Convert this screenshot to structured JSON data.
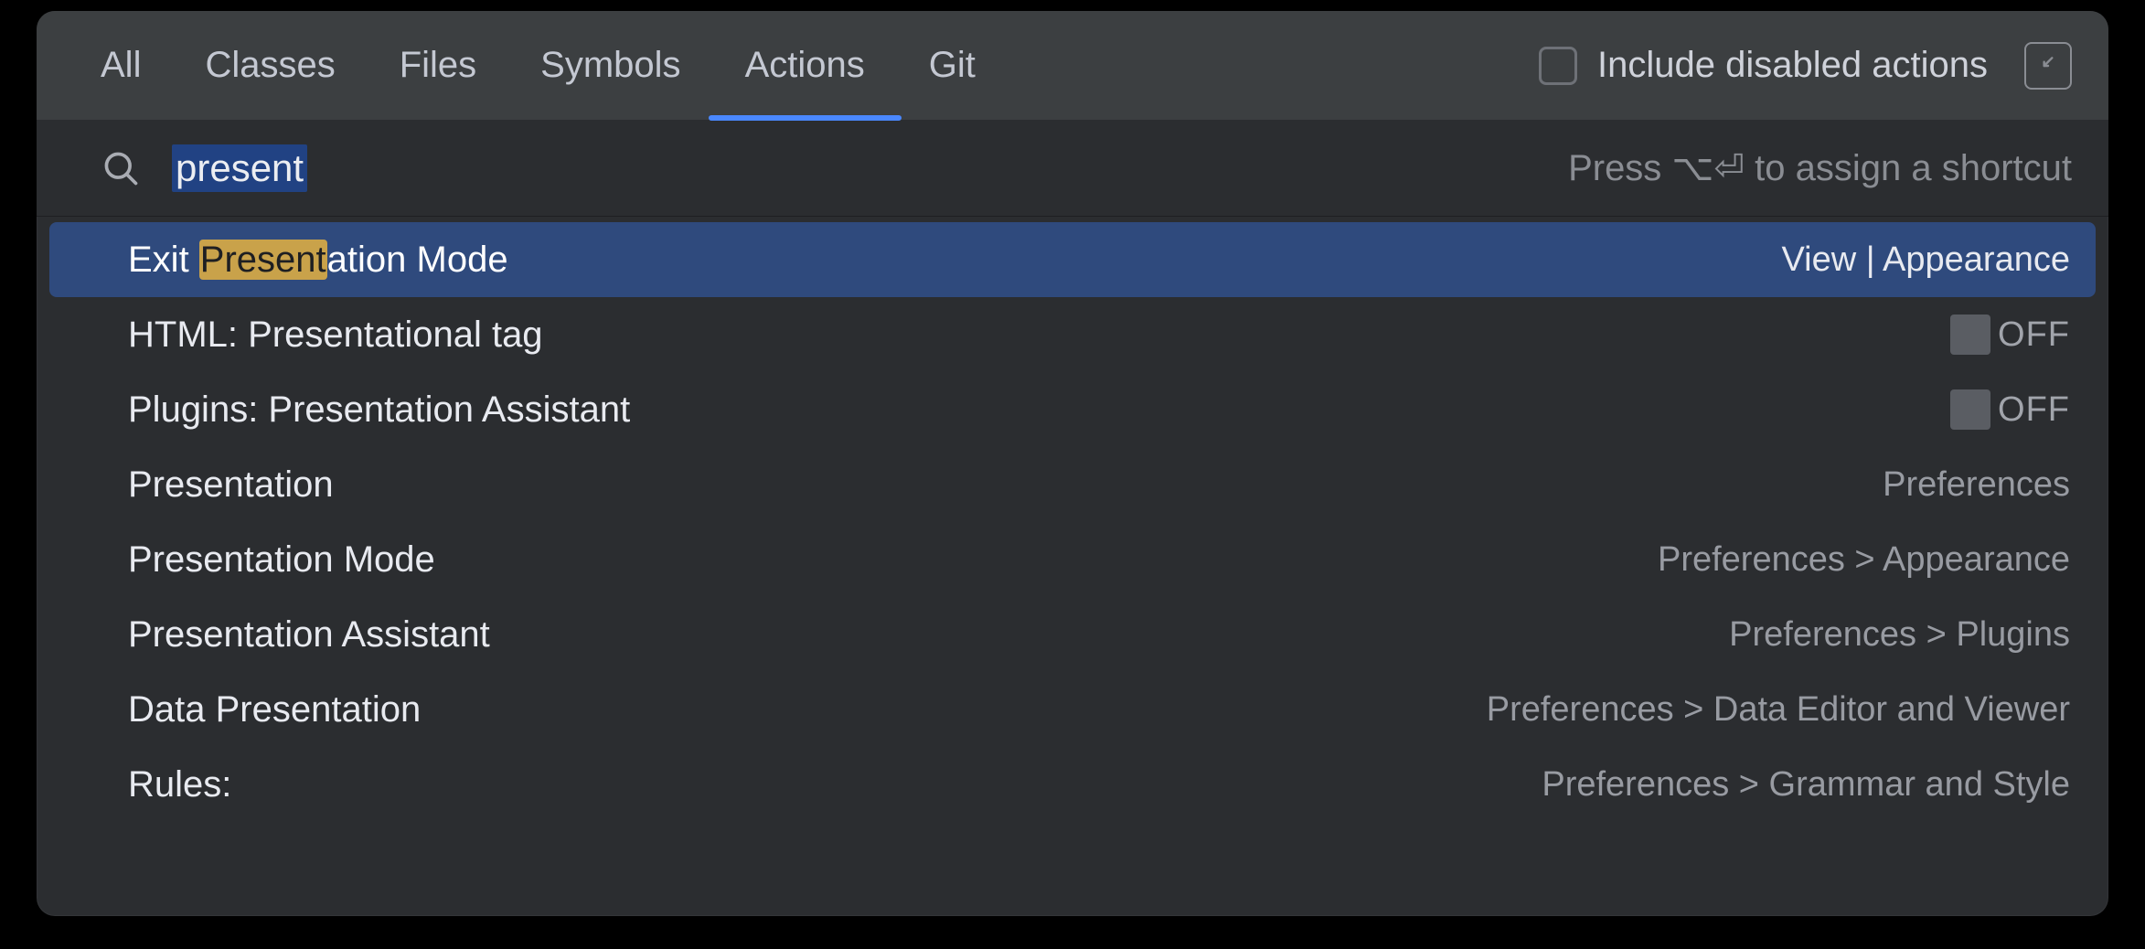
{
  "tabs": [
    "All",
    "Classes",
    "Files",
    "Symbols",
    "Actions",
    "Git"
  ],
  "active_tab_index": 4,
  "checkbox": {
    "label": "Include disabled actions",
    "checked": false
  },
  "search": {
    "query": "present",
    "hint": "Press ⌥⏎ to assign a shortcut"
  },
  "results": [
    {
      "selected": true,
      "highlight": {
        "pre": "Exit ",
        "match": "Present",
        "post": "ation Mode"
      },
      "rhs_kind": "path",
      "rhs": "View | Appearance"
    },
    {
      "label": "HTML: Presentational tag",
      "rhs_kind": "toggle",
      "rhs": "OFF"
    },
    {
      "label": "Plugins: Presentation Assistant",
      "rhs_kind": "toggle",
      "rhs": "OFF"
    },
    {
      "label": "Presentation",
      "rhs_kind": "path",
      "rhs": "Preferences"
    },
    {
      "label": "Presentation Mode",
      "rhs_kind": "path",
      "rhs": "Preferences > Appearance"
    },
    {
      "label": "Presentation Assistant",
      "rhs_kind": "path",
      "rhs": "Preferences > Plugins"
    },
    {
      "label": "Data Presentation",
      "rhs_kind": "path",
      "rhs": "Preferences > Data Editor and Viewer"
    },
    {
      "label": "Rules:",
      "rhs_kind": "path",
      "rhs": "Preferences > Grammar and Style"
    }
  ]
}
